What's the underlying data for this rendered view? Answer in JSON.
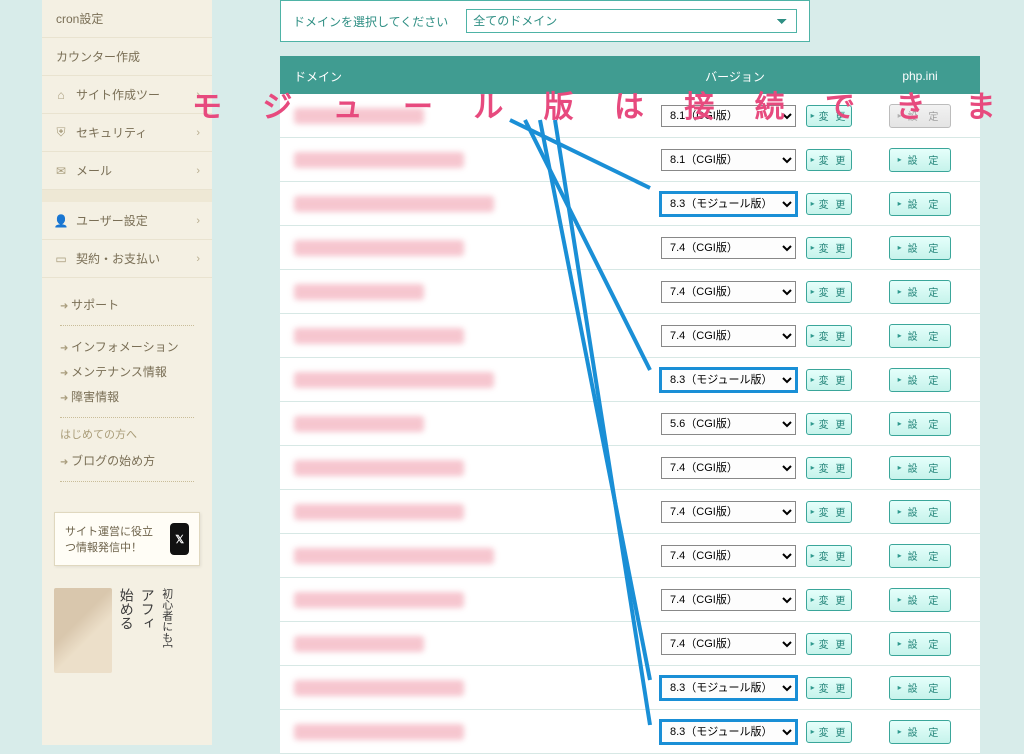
{
  "sidebar": {
    "items": [
      {
        "label": "cron設定"
      },
      {
        "label": "カウンター作成"
      },
      {
        "label": "サイト作成ツー",
        "icon": "monitor-icon",
        "chevron": "›"
      },
      {
        "label": "セキュリティ",
        "icon": "shield-icon",
        "chevron": "›"
      },
      {
        "label": "メール",
        "icon": "mail-icon",
        "chevron": "›"
      },
      {
        "label": "ユーザー設定",
        "icon": "user-icon",
        "chevron": "›"
      },
      {
        "label": "契約・お支払い",
        "icon": "creditcard-icon",
        "chevron": "›"
      }
    ],
    "support": {
      "items": [
        "サポート",
        "インフォメーション",
        "メンテナンス情報",
        "障害情報"
      ],
      "first_time_head": "はじめての方へ",
      "first_time_link": "ブログの始め方"
    },
    "promo": {
      "text": "サイト運営に役立つ情報発信中！",
      "badge": "𝕏"
    },
    "ad": {
      "line1": "アフィ",
      "line2": "始める",
      "line3": "初心者にも宀"
    }
  },
  "selector": {
    "label": "ドメインを選択してください",
    "value": "全てのドメイン"
  },
  "table": {
    "headers": {
      "domain": "ドメイン",
      "version": "バージョン",
      "phpini": "php.ini"
    },
    "change_label": "変 更",
    "settings_label": "設 定",
    "rows": [
      {
        "version": "8.1（CGI版）",
        "hl": false,
        "first": true
      },
      {
        "version": "8.1（CGI版）",
        "hl": false
      },
      {
        "version": "8.3（モジュール版）",
        "hl": true
      },
      {
        "version": "7.4（CGI版）",
        "hl": false
      },
      {
        "version": "7.4（CGI版）",
        "hl": false
      },
      {
        "version": "7.4（CGI版）",
        "hl": false
      },
      {
        "version": "8.3（モジュール版）",
        "hl": true
      },
      {
        "version": "5.6（CGI版）",
        "hl": false
      },
      {
        "version": "7.4（CGI版）",
        "hl": false
      },
      {
        "version": "7.4（CGI版）",
        "hl": false
      },
      {
        "version": "7.4（CGI版）",
        "hl": false
      },
      {
        "version": "7.4（CGI版）",
        "hl": false
      },
      {
        "version": "7.4（CGI版）",
        "hl": false
      },
      {
        "version": "8.3（モジュール版）",
        "hl": true
      },
      {
        "version": "8.3（モジュール版）",
        "hl": true
      }
    ]
  },
  "annotation": "モ ジ ュ ー ル 版 は 接 続 で き ま す ！"
}
